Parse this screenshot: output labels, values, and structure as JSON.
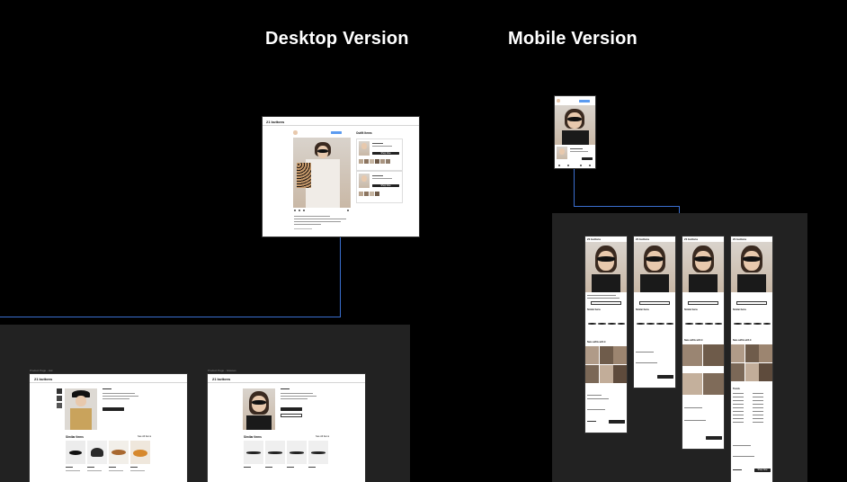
{
  "headings": {
    "desktop": "Desktop Version",
    "mobile": "Mobile Version"
  },
  "brand": {
    "logo_text": "21 buttons"
  },
  "colors": {
    "canvas": "#000000",
    "panel": "#222222",
    "connector": "#3b6fd1",
    "accent": "#5b9bf0"
  },
  "desktop_post": {
    "sidebar_title": "Outfit Items",
    "button_label": "Shop Now"
  },
  "similar_items": {
    "title": "Similar Items",
    "see_all": "See All Items"
  },
  "mobile_feed": {
    "title": "Similar Items",
    "more_title": "New outfits with it",
    "trends_title": "Trends",
    "shop_button": "Shop Now"
  }
}
